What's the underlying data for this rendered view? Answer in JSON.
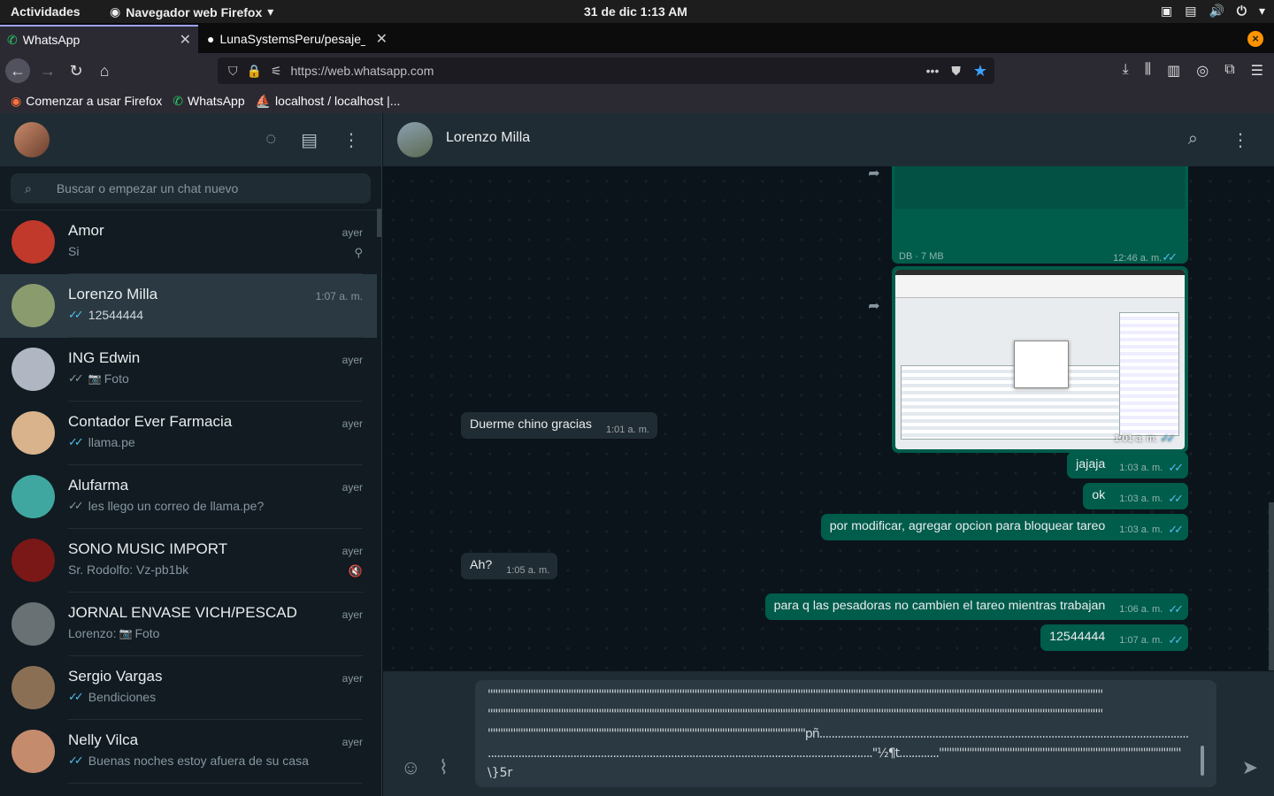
{
  "system": {
    "activities": "Actividades",
    "app_menu": "Navegador web Firefox",
    "clock": "31 de dic  1:13 AM"
  },
  "browser": {
    "tabs": [
      {
        "label": "WhatsApp",
        "active": true
      },
      {
        "label": "LunaSystemsPeru/pesaje_c",
        "active": false
      }
    ],
    "url": "https://web.whatsapp.com",
    "bookmarks": [
      "Comenzar a usar Firefox",
      "WhatsApp",
      "localhost / localhost |..."
    ]
  },
  "sidebar": {
    "search_placeholder": "Buscar o empezar un chat nuevo",
    "chats": [
      {
        "name": "Amor",
        "time": "ayer",
        "preview": "Si",
        "ticks": "none",
        "badge": "pin-icon"
      },
      {
        "name": "Lorenzo Milla",
        "time": "1:07 a. m.",
        "preview": "12544444",
        "ticks": "blue",
        "selected": true
      },
      {
        "name": "ING Edwin",
        "time": "ayer",
        "preview": "Foto",
        "ticks": "grey",
        "camera": true
      },
      {
        "name": "Contador Ever Farmacia",
        "time": "ayer",
        "preview": "llama.pe",
        "ticks": "blue"
      },
      {
        "name": "Alufarma",
        "time": "ayer",
        "preview": "les llego un correo de llama.pe?",
        "ticks": "grey"
      },
      {
        "name": "SONO MUSIC IMPORT",
        "time": "ayer",
        "preview": "Sr. Rodolfo: Vz-pb1bk",
        "ticks": "none",
        "badge": "muted-icon"
      },
      {
        "name": "JORNAL ENVASE VICH/PESCAD",
        "time": "ayer",
        "preview": "Lorenzo: ",
        "preview_tail": "Foto",
        "ticks": "none",
        "camera": true
      },
      {
        "name": "Sergio Vargas",
        "time": "ayer",
        "preview": "Bendiciones",
        "ticks": "blue"
      },
      {
        "name": "Nelly Vilca",
        "time": "ayer",
        "preview": "Buenas noches estoy afuera de su casa",
        "ticks": "blue"
      }
    ]
  },
  "conversation": {
    "contact": "Lorenzo Milla",
    "document": {
      "info": "DB · 7 MB",
      "time": "12:46 a. m."
    },
    "image": {
      "time": "1:01 a. m."
    },
    "messages": [
      {
        "dir": "in",
        "text": "Duerme chino gracias",
        "time": "1:01 a. m."
      },
      {
        "dir": "out",
        "text": "jajaja",
        "time": "1:03 a. m."
      },
      {
        "dir": "out",
        "text": "ok",
        "time": "1:03 a. m."
      },
      {
        "dir": "out",
        "text": "por modificar, agregar opcion para bloquear tareo",
        "time": "1:03 a. m."
      },
      {
        "dir": "in",
        "text": "Ah?",
        "time": "1:05 a. m."
      },
      {
        "dir": "out",
        "text": "para q las pesadoras no cambien el tareo mientras trabajan",
        "time": "1:06 a. m."
      },
      {
        "dir": "out",
        "text": "12544444",
        "time": "1:07 a. m."
      }
    ],
    "composer_lines": [
      "''''''''''''''''''''''''''''''''''''''''''''''''''''''''''''''''''''''''''''''''''''''''''''''''''''''''''''''''''''''''''''''''''''''''''''''''''''''''''''''''''''''''''''''''''''''''''''''''''''''''''''''''''''''''''''''''''''''''''''''''''''",
      "''''''''''''''''''''''''''''''''''''''''''''''''''''''''''''''''''''''''''''''''''''''''''''''''''''''''''''''''''''''''''''''''''''''''''''''''''''''''''''''''''''''''''''''''''''''''''''''''''''''''''''''''''''''''''''''''''''''''''''''''''''",
      "''''''''''''''''''''''''''''''''''''''''''''''''''''''''''''''''''''''''''''''''''''''''''''''''''''''''''''''''''''''''''''''pñ.........................................................................................................................",
      "..............................................................................................................................\"½¶t.............''''''''''''''''''''''''''''''''''''''''''''''''''''''''''''''''''''''''''''''''''''''''''''''''",
      "\\}5r"
    ]
  }
}
